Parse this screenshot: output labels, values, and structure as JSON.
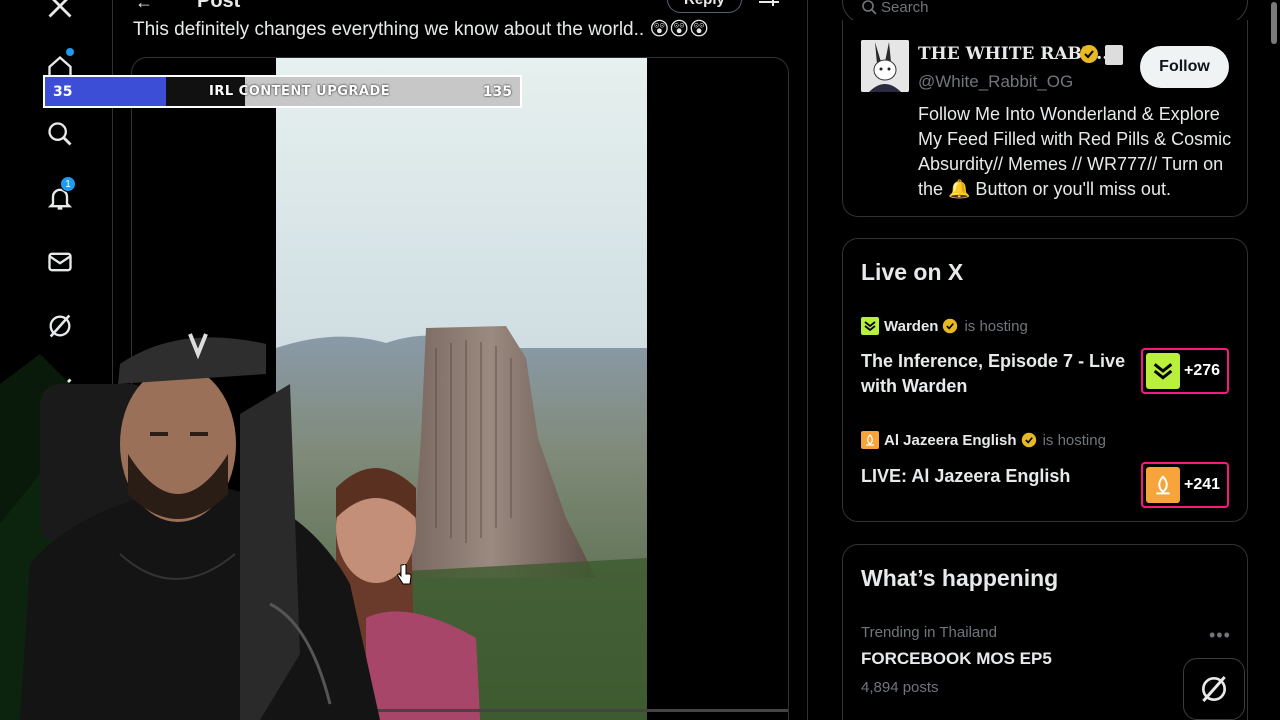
{
  "header": {
    "title": "Post",
    "reply_label": "Reply"
  },
  "tweet": {
    "text": "This definitely changes everything we know about the world.. 😲😲😲"
  },
  "stream_overlay": {
    "goal_start": "35",
    "goal_label": "IRL CONTENT UPGRADE",
    "goal_end": "135",
    "goal_progress": 0.26
  },
  "nav": {
    "notifications_badge": "1",
    "items": [
      "x-logo-icon",
      "home-icon",
      "search-icon",
      "bell-icon",
      "mail-icon",
      "grok-icon",
      "x-premium-icon",
      "communities-icon"
    ]
  },
  "search": {
    "placeholder": "Search"
  },
  "profile": {
    "display_name": "THE WHITE RABB...",
    "handle": "@White_Rabbit_OG",
    "follow_label": "Follow",
    "bio": "Follow Me Into Wonderland & Explore My Feed Filled with Red Pills & Cosmic Absurdity// Memes // WR777// Turn on the 🔔 Button or you'll miss out."
  },
  "live": {
    "title": "Live on X",
    "spaces": [
      {
        "host": "Warden",
        "status": "is hosting",
        "title": "The Inference, Episode 7 - Live with Warden",
        "listeners": "+276",
        "color": "#b8f03c"
      },
      {
        "host": "Al Jazeera English",
        "status": "is hosting",
        "title": "LIVE: Al Jazeera English",
        "listeners": "+241",
        "color": "#f7a43a"
      }
    ]
  },
  "trends": {
    "title": "What’s happening",
    "items": [
      {
        "meta": "Trending in Thailand",
        "name": "FORCEBOOK MOS EP5",
        "count": "4,894 posts"
      }
    ]
  },
  "colors": {
    "accent": "#1d9bf0",
    "verified": "#e8b923",
    "live_border": "#f91880",
    "goal_fill": "#3d4ed6"
  }
}
